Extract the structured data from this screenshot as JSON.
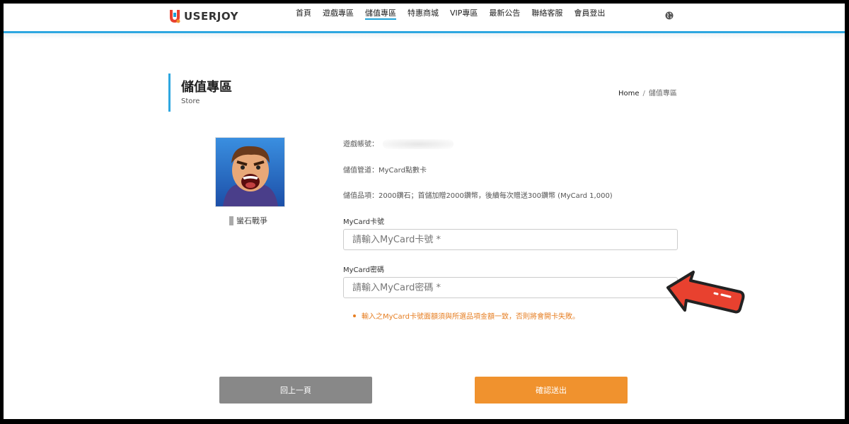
{
  "header": {
    "logo_text": "USERJOY",
    "nav": [
      {
        "label": "首頁"
      },
      {
        "label": "遊戲專區"
      },
      {
        "label": "儲值專區"
      },
      {
        "label": "特惠商城"
      },
      {
        "label": "VIP專區"
      },
      {
        "label": "最新公告"
      },
      {
        "label": "聯絡客服"
      },
      {
        "label": "會員登出"
      }
    ],
    "active_nav_index": 2
  },
  "page": {
    "title": "儲值專區",
    "subtitle": "Store",
    "breadcrumb": {
      "home": "Home",
      "separator": "/",
      "current": "儲值專區"
    }
  },
  "game": {
    "name": "蠻石戰爭"
  },
  "info": {
    "account_label": "遊戲帳號：",
    "channel": "儲值管道：MyCard點數卡",
    "item": "儲值品項：2000鑽石；首儲加贈2000鑽幣，後續每次贈送300鑽幣 (MyCard 1,000)"
  },
  "form": {
    "card_number_label": "MyCard卡號",
    "card_number_placeholder": "請輸入MyCard卡號 *",
    "card_password_label": "MyCard密碼",
    "card_password_placeholder": "請輸入MyCard密碼 *",
    "notice": "輸入之MyCard卡號面額須與所選品項金額一致，否則將會開卡失敗。"
  },
  "buttons": {
    "back": "回上一頁",
    "confirm": "確認送出"
  },
  "colors": {
    "accent": "#2ea7e0",
    "confirm": "#f0922e",
    "back": "#888888",
    "notice": "#e67e22",
    "arrow": "#e8412f"
  }
}
